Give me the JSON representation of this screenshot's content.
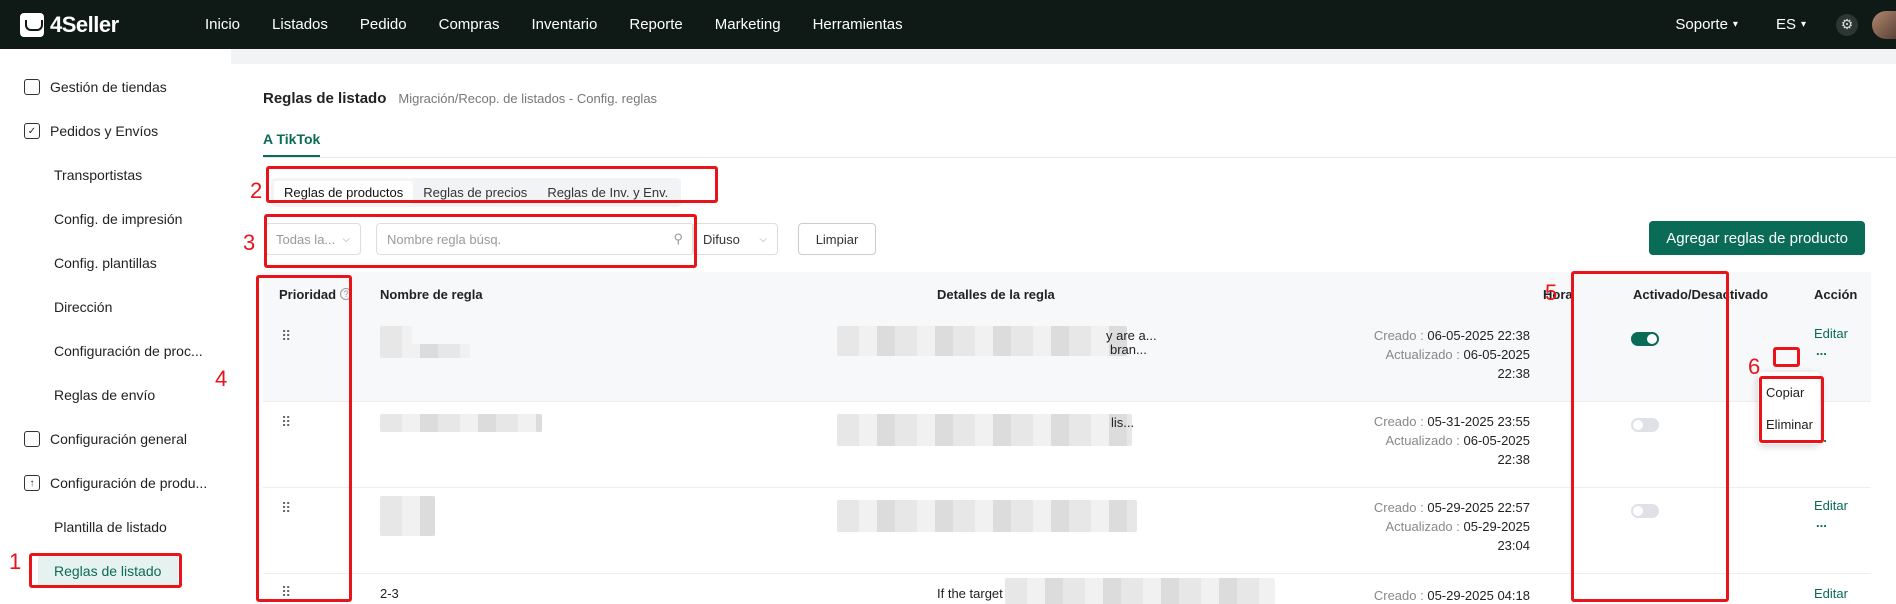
{
  "app": {
    "logo": "4Seller"
  },
  "nav": [
    "Inicio",
    "Listados",
    "Pedido",
    "Compras",
    "Inventario",
    "Reporte",
    "Marketing",
    "Herramientas"
  ],
  "top_right": {
    "support": "Soporte",
    "lang": "ES"
  },
  "sidebar": {
    "items": [
      {
        "label": "Gestión de tiendas",
        "icon": "store-icon"
      },
      {
        "label": "Pedidos y Envíos",
        "icon": "clipboard-check-icon"
      },
      {
        "label": "Transportistas"
      },
      {
        "label": "Config. de impresión"
      },
      {
        "label": "Config. plantillas"
      },
      {
        "label": "Dirección"
      },
      {
        "label": "Configuración de proc..."
      },
      {
        "label": "Reglas de envío"
      },
      {
        "label": "Configuración general",
        "icon": "printer-icon"
      },
      {
        "label": "Configuración de produ...",
        "icon": "upload-box-icon"
      },
      {
        "label": "Plantilla de listado"
      },
      {
        "label": "Reglas de listado"
      }
    ]
  },
  "header": {
    "title": "Reglas de listado",
    "breadcrumb": "Migración/Recop. de listados - Config. reglas"
  },
  "tab": "A TikTok",
  "subtabs": [
    "Reglas de productos",
    "Reglas de precios",
    "Reglas de Inv. y Env."
  ],
  "filters": {
    "store_placeholder": "Todas la...",
    "search_placeholder": "Nombre regla búsq.",
    "match_mode": "Difuso",
    "clear_label": "Limpiar"
  },
  "add_button": "Agregar reglas de producto",
  "columns": {
    "priority": "Prioridad",
    "name": "Nombre de regla",
    "details": "Detalles de la regla",
    "time": "Hora",
    "status": "Activado/Desactivado",
    "action": "Acción"
  },
  "rows": [
    {
      "name": "",
      "details_a": "y are a...",
      "details_b": "bran...",
      "created_label": "Creado : ",
      "created": "06-05-2025 22:38",
      "updated_label": "Actualizado : ",
      "updated_date": "06-05-2025",
      "updated_time": "22:38",
      "enabled": true,
      "edit": "Editar",
      "more": "..."
    },
    {
      "name": "",
      "details_a": "lis...",
      "details_b": "",
      "created_label": "Creado : ",
      "created": "05-31-2025 23:55",
      "updated_label": "Actualizado : ",
      "updated_date": "06-05-2025",
      "updated_time": "22:38",
      "enabled": false,
      "edit": "",
      "more": "..."
    },
    {
      "name": "",
      "details_a": "",
      "details_b": "",
      "created_label": "Creado : ",
      "created": "05-29-2025 22:57",
      "updated_label": "Actualizado : ",
      "updated_date": "05-29-2025",
      "updated_time": "23:04",
      "enabled": false,
      "edit": "Editar",
      "more": "..."
    },
    {
      "name": "2-3",
      "details_a": "If the target sho",
      "details_b": "",
      "created_label": "Creado : ",
      "created": "05-29-2025 04:18",
      "updated_label": "",
      "updated_date": "",
      "updated_time": "",
      "enabled": false,
      "edit": "Editar",
      "more": ""
    }
  ],
  "dropdown_menu": [
    "Copiar",
    "Eliminar"
  ],
  "annotations": [
    "1",
    "2",
    "3",
    "4",
    "5",
    "6"
  ],
  "colors": {
    "accent": "#0a6b57",
    "annotation": "#e8141a",
    "topbar": "#0f1a17"
  }
}
